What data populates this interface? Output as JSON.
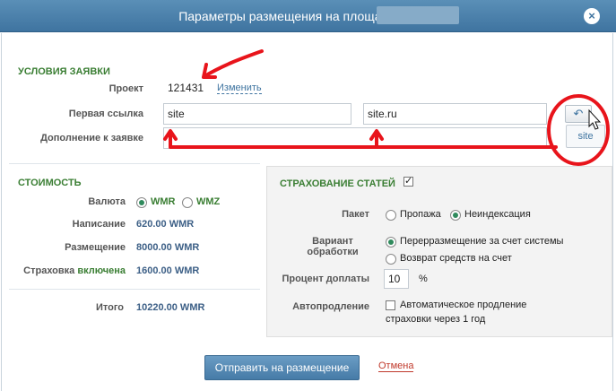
{
  "dialog": {
    "title": "Параметры размещения на площадке",
    "close_glyph": "×"
  },
  "conditions": {
    "section_title": "УСЛОВИЯ ЗАЯВКИ",
    "project_label": "Проект",
    "project_value": "121431",
    "change_link": "Изменить",
    "first_link_label": "Первая ссылка",
    "first_link_value": "site",
    "url_value": "site.ru",
    "addition_label": "Дополнение к заявке",
    "addition_value": "",
    "undo_icon": "undo-icon",
    "suggestion": "site"
  },
  "cost": {
    "section_title": "СТОИМОСТЬ",
    "currency_label": "Валюта",
    "currency_options": [
      "WMR",
      "WMZ"
    ],
    "currency_selected": "WMR",
    "writing_label": "Написание",
    "writing_value": "620.00 WMR",
    "placement_label": "Размещение",
    "placement_value": "8000.00 WMR",
    "insurance_label": "Страховка",
    "insurance_status": "включена",
    "insurance_value": "1600.00 WMR",
    "total_label": "Итого",
    "total_value": "10220.00 WMR"
  },
  "insurance": {
    "section_title": "СТРАХОВАНИЕ СТАТЕЙ",
    "enabled": true,
    "package_label": "Пакет",
    "package_options": [
      "Пропажа",
      "Неиндексация"
    ],
    "package_selected": "Неиндексация",
    "variant_label_1": "Вариант",
    "variant_label_2": "обработки",
    "variant_options": [
      "Перерразмещение за счет системы",
      "Возврат средств на счет"
    ],
    "variant_selected": "Перерразмещение за счет системы",
    "percent_label": "Процент доплаты",
    "percent_value": "10",
    "percent_unit": "%",
    "autorenew_label": "Автопродление",
    "autorenew_text_1": "Автоматическое продление",
    "autorenew_text_2": "страховки через 1 год",
    "autorenew_checked": false
  },
  "footer": {
    "submit_label": "Отправить на размещение",
    "cancel_label": "Отмена"
  },
  "colors": {
    "title_bar": "#4a80ab",
    "section_green": "#3a7e33",
    "value_blue": "#3c5f86",
    "annotation_red": "#e8141b"
  }
}
